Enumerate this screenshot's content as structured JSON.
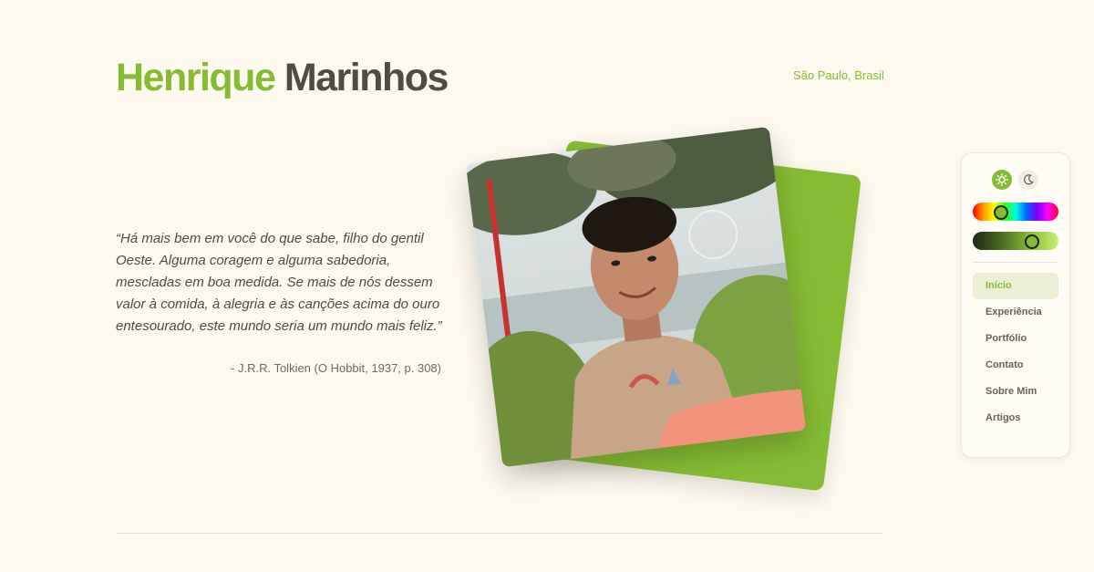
{
  "header": {
    "first_name": "Henrique",
    "last_name": "Marinhos",
    "location": "São Paulo, Brasil"
  },
  "quote": {
    "text": "“Há mais bem em você do que sabe, filho do gentil Oeste. Alguma coragem e alguma sabedoria, mescladas em boa medida. Se mais de nós dessem valor à comida, à alegria e às canções acima do ouro entesourado, este mundo seria um mundo mais feliz.”",
    "attribution": "- J.R.R. Tolkien (O Hobbit, 1937, p. 308)"
  },
  "theme_panel": {
    "light_icon": "sun-icon",
    "dark_icon": "moon-icon",
    "active_theme": "light",
    "hue_slider_level": 0.3,
    "shade_slider_level": 0.73,
    "nav": [
      {
        "label": "Início",
        "active": true
      },
      {
        "label": "Experiência",
        "active": false
      },
      {
        "label": "Portfólio",
        "active": false
      },
      {
        "label": "Contato",
        "active": false
      },
      {
        "label": "Sobre Mim",
        "active": false
      },
      {
        "label": "Artigos",
        "active": false
      }
    ]
  },
  "colors": {
    "accent": "#86bc34",
    "background": "#fdf9ee",
    "text": "#4f4c46"
  }
}
